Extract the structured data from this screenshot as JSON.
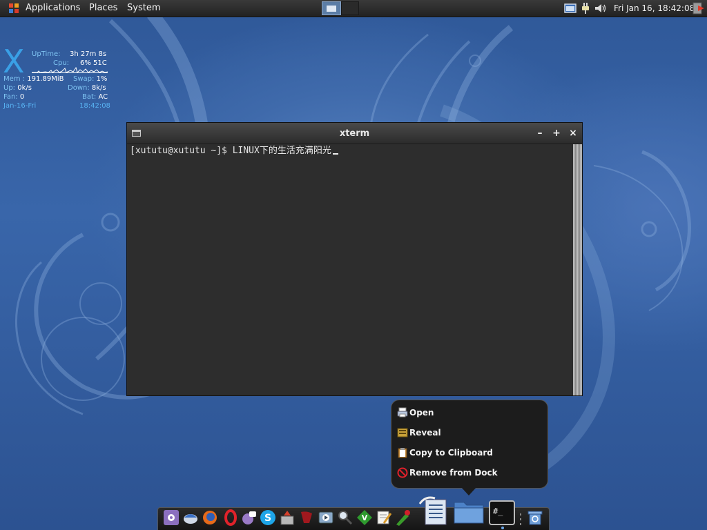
{
  "top_panel": {
    "menus": [
      "Applications",
      "Places",
      "System"
    ],
    "clock": "Fri Jan 16, 18:42:08"
  },
  "conky": {
    "logo": "X",
    "uptime_label": "UpTime:",
    "uptime_value": "3h 27m 8s",
    "cpu_label": "Cpu:",
    "cpu_value": "6% 51C",
    "mem_label": "Mem :",
    "mem_value": "191.89MiB",
    "swap_label": "Swap:",
    "swap_value": "1%",
    "up_label": "Up:",
    "up_value": "0k/s",
    "down_label": "Down:",
    "down_value": "8k/s",
    "fan_label": "Fan:",
    "fan_value": "0",
    "bat_label": "Bat:",
    "bat_value": "AC",
    "date": "Jan-16-Fri",
    "time": "18:42:08"
  },
  "xterm": {
    "title": "xterm",
    "min_label": "–",
    "max_label": "+",
    "close_label": "×",
    "prompt_line": "[xututu@xututu ~]$ LINUX下的生活充满阳光"
  },
  "context_menu": {
    "items": [
      {
        "label": "Open",
        "icon": "printer-icon"
      },
      {
        "label": "Reveal",
        "icon": "reveal-icon"
      },
      {
        "label": "Copy to Clipboard",
        "icon": "clipboard-icon"
      },
      {
        "label": "Remove from Dock",
        "icon": "no-entry-icon"
      }
    ]
  },
  "dock": {
    "items": [
      "settings",
      "thunderbird",
      "firefox",
      "opera",
      "pidgin",
      "skype",
      "installer",
      "wine",
      "vlc",
      "search",
      "gvim",
      "text-editor",
      "inkscape",
      "openoffice-writer",
      "folder",
      "terminal",
      "trash"
    ],
    "terminal_label": "#_"
  },
  "colors": {
    "panel": "#2b2b2b",
    "accent": "#3aa0e6",
    "conky_label": "#7fc4f2",
    "terminal_bg": "#2d2d2d"
  }
}
